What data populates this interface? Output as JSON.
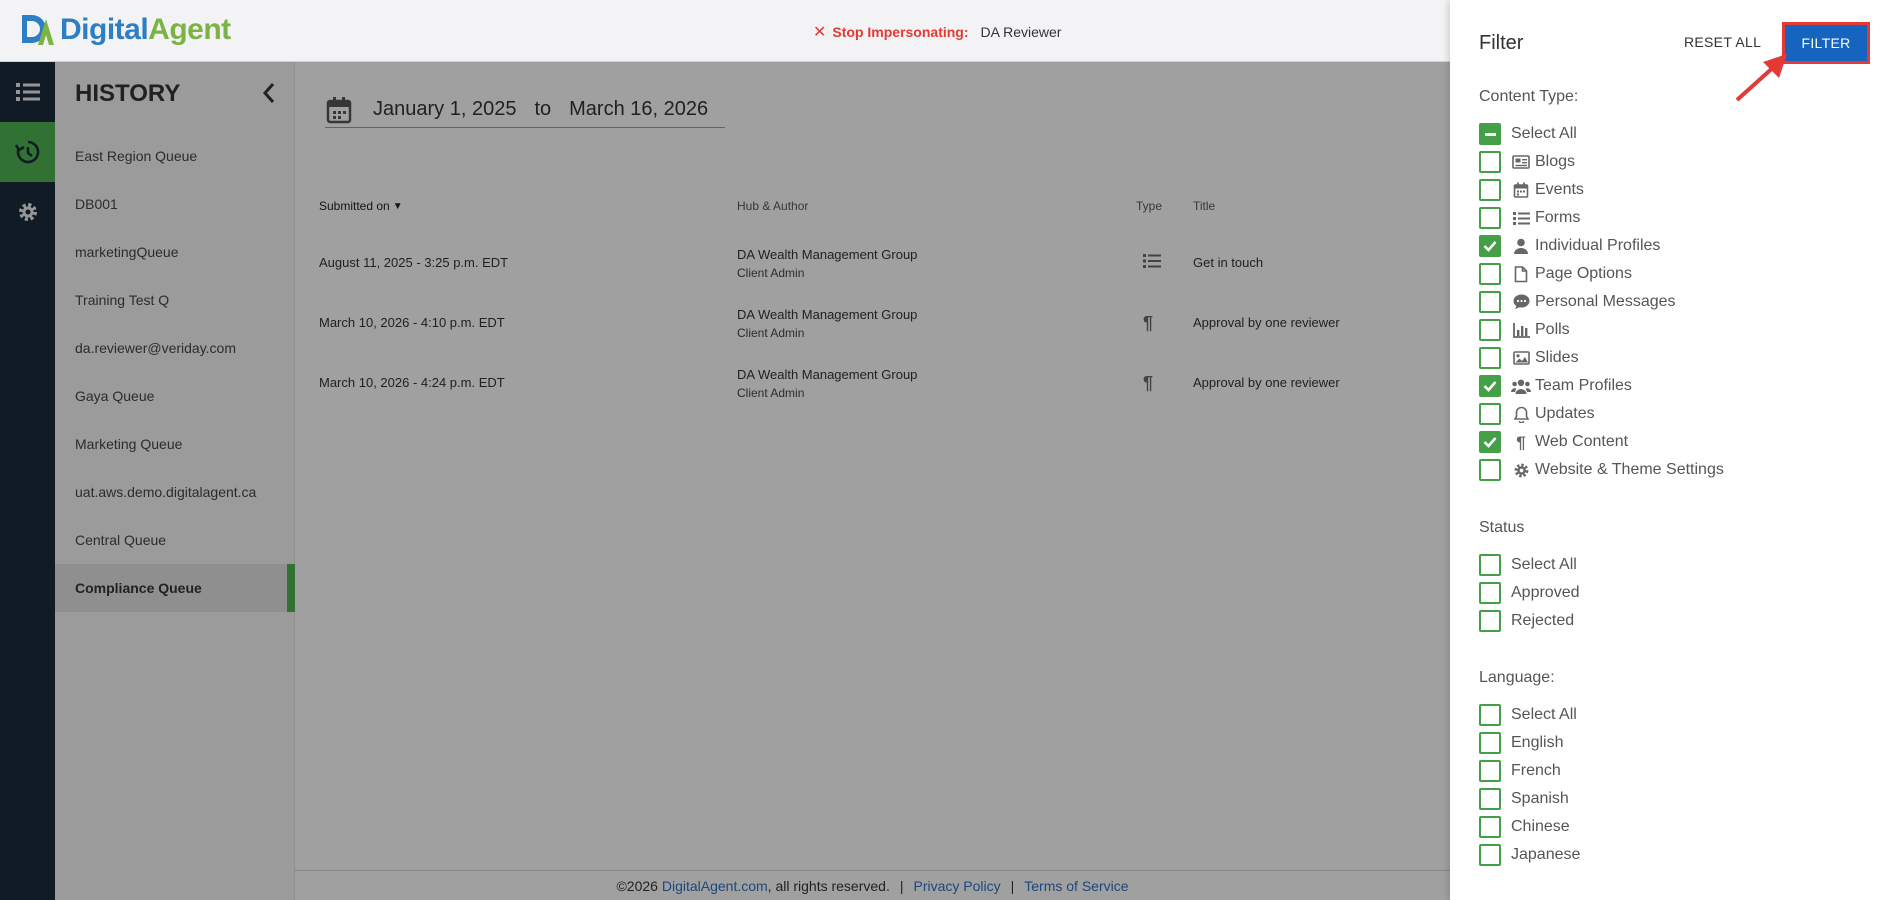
{
  "app": {
    "logo_text_a": "Digital",
    "logo_text_b": "Agent",
    "impersonate_label": "Stop Impersonating:",
    "impersonate_name": "DA Reviewer"
  },
  "history": {
    "title": "HISTORY",
    "queues": [
      "East Region Queue",
      "DB001",
      "marketingQueue",
      "Training Test Q",
      "da.reviewer@veriday.com",
      "Gaya Queue",
      "Marketing Queue",
      "uat.aws.demo.digitalagent.ca",
      "Central Queue",
      "Compliance Queue"
    ],
    "active_queue": "Compliance Queue"
  },
  "daterange": {
    "from": "January 1, 2025",
    "to_label": "to",
    "to": "March 16, 2026"
  },
  "table": {
    "headers": {
      "submitted": "Submitted on",
      "hub": "Hub & Author",
      "type": "Type",
      "title": "Title"
    },
    "rows": [
      {
        "date": "August 11, 2025 - 3:25 p.m. EDT",
        "hub": "DA Wealth Management Group",
        "author": "Client Admin",
        "type_icon": "list-icon",
        "title": "Get in touch"
      },
      {
        "date": "March 10, 2026 - 4:10 p.m. EDT",
        "hub": "DA Wealth Management Group",
        "author": "Client Admin",
        "type_icon": "paragraph-icon",
        "title": "Approval by one reviewer"
      },
      {
        "date": "March 10, 2026 - 4:24 p.m. EDT",
        "hub": "DA Wealth Management Group",
        "author": "Client Admin",
        "type_icon": "paragraph-icon",
        "title": "Approval by one reviewer"
      }
    ]
  },
  "footer": {
    "copyright": "©2026",
    "site": "DigitalAgent.com",
    "rights": ", all rights reserved.",
    "sep": "|",
    "privacy": "Privacy Policy",
    "terms": "Terms of Service"
  },
  "filter": {
    "title": "Filter",
    "reset_label": "RESET ALL",
    "apply_label": "FILTER",
    "content_type_label": "Content Type:",
    "content_types": [
      {
        "label": "Select All",
        "state": "partial",
        "icon": ""
      },
      {
        "label": "Blogs",
        "state": "unchecked",
        "icon": "newspaper-icon"
      },
      {
        "label": "Events",
        "state": "unchecked",
        "icon": "calendar-icon"
      },
      {
        "label": "Forms",
        "state": "unchecked",
        "icon": "list-icon"
      },
      {
        "label": "Individual Profiles",
        "state": "checked",
        "icon": "person-icon"
      },
      {
        "label": "Page Options",
        "state": "unchecked",
        "icon": "file-icon"
      },
      {
        "label": "Personal Messages",
        "state": "unchecked",
        "icon": "chat-icon"
      },
      {
        "label": "Polls",
        "state": "unchecked",
        "icon": "bar-chart-icon"
      },
      {
        "label": "Slides",
        "state": "unchecked",
        "icon": "image-icon"
      },
      {
        "label": "Team Profiles",
        "state": "checked",
        "icon": "people-icon"
      },
      {
        "label": "Updates",
        "state": "unchecked",
        "icon": "bell-icon"
      },
      {
        "label": "Web Content",
        "state": "checked",
        "icon": "paragraph-icon"
      },
      {
        "label": "Website & Theme Settings",
        "state": "unchecked",
        "icon": "gear-icon"
      }
    ],
    "status_label": "Status",
    "statuses": [
      {
        "label": "Select All",
        "state": "unchecked"
      },
      {
        "label": "Approved",
        "state": "unchecked"
      },
      {
        "label": "Rejected",
        "state": "unchecked"
      }
    ],
    "language_label": "Language:",
    "languages": [
      {
        "label": "Select All",
        "state": "unchecked"
      },
      {
        "label": "English",
        "state": "unchecked"
      },
      {
        "label": "French",
        "state": "unchecked"
      },
      {
        "label": "Spanish",
        "state": "unchecked"
      },
      {
        "label": "Chinese",
        "state": "unchecked"
      },
      {
        "label": "Japanese",
        "state": "unchecked"
      }
    ]
  },
  "colors": {
    "accent_green": "#43a047",
    "primary_blue": "#1565c0",
    "alert_red": "#e53935",
    "rail_bg": "#1a2a3a"
  }
}
